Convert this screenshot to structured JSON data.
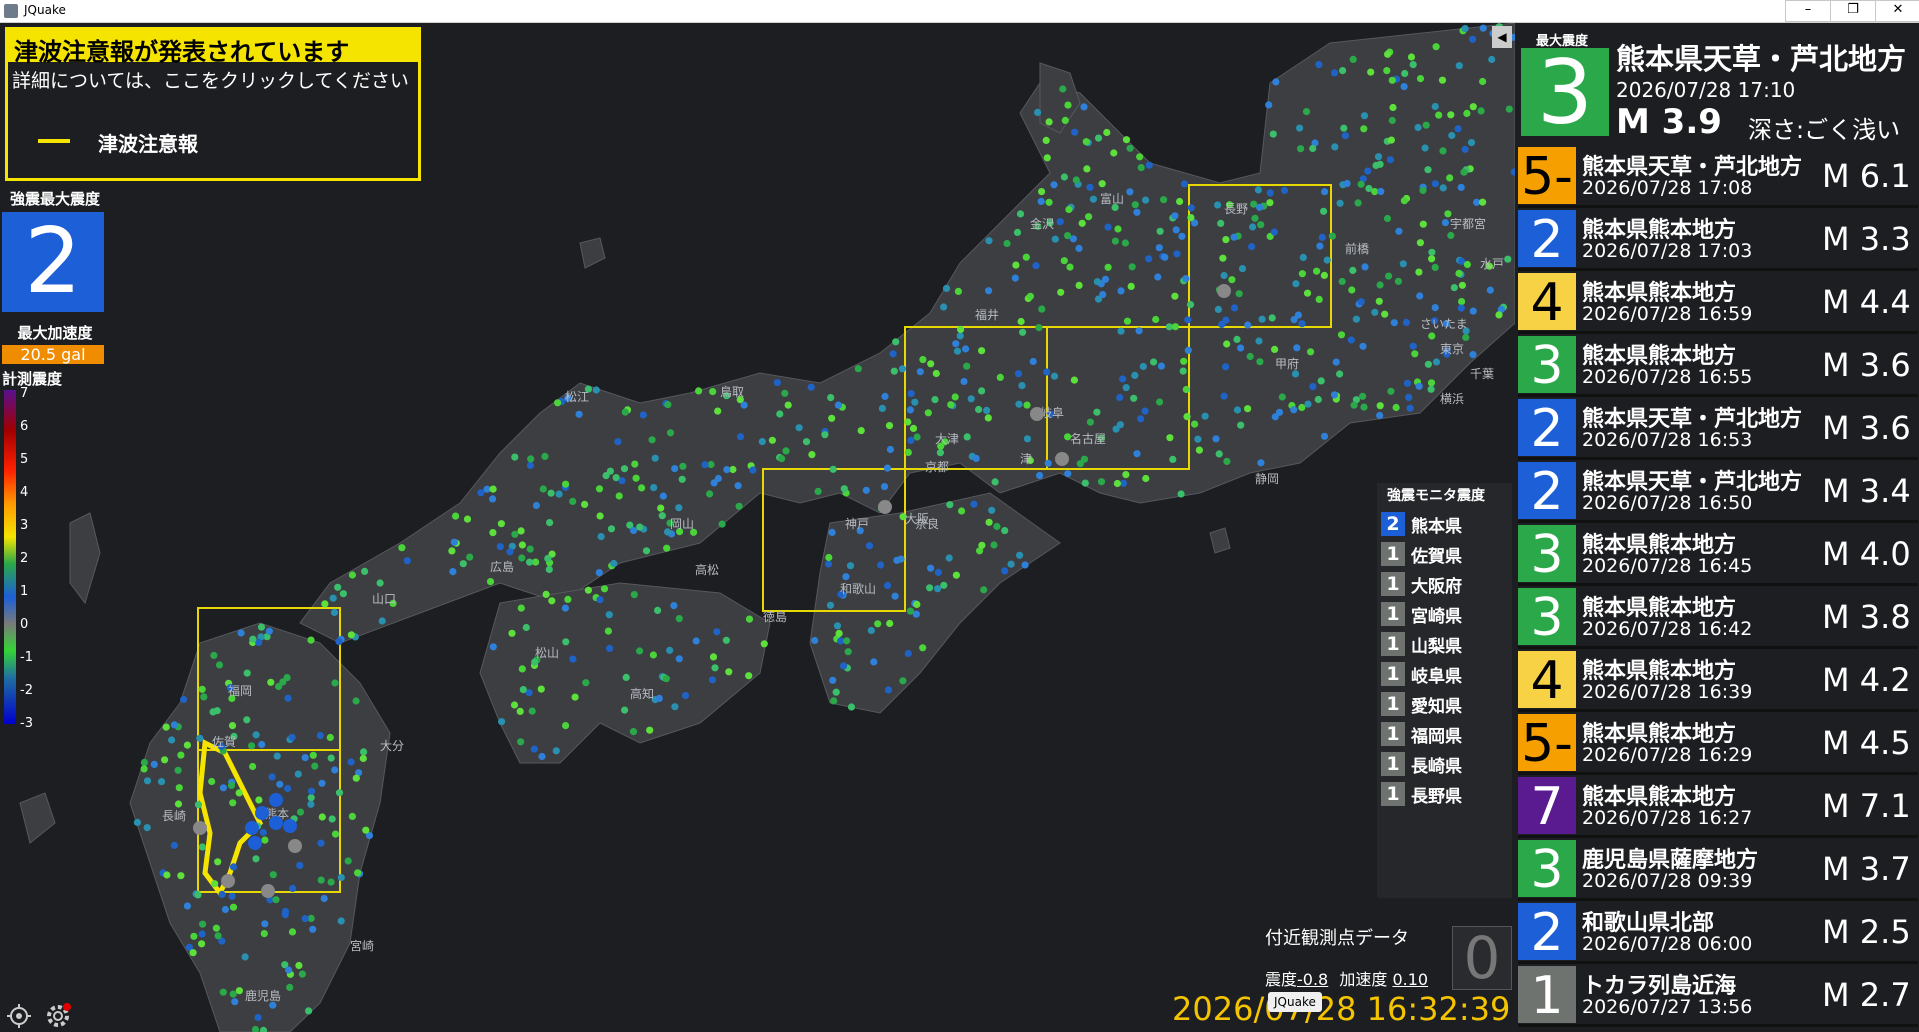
{
  "window": {
    "title": "JQuake",
    "minimize": "–",
    "maximize": "❐",
    "close": "✕"
  },
  "tsunami": {
    "header": "津波注意報が発表されています",
    "sub": "詳細については、ここをクリックしてください",
    "legend": "津波注意報"
  },
  "max_panel": {
    "label": "強震最大震度",
    "value": "2",
    "accel_label": "最大加速度",
    "accel_value": "20.5 gal"
  },
  "scale": {
    "label": "計測震度",
    "ticks": [
      "7",
      "6",
      "5",
      "4",
      "3",
      "2",
      "1",
      "0",
      "-1",
      "-2",
      "-3"
    ]
  },
  "map_labels": [
    "長野",
    "前橋",
    "宇都宮",
    "水戸",
    "さいたま",
    "東京",
    "千葉",
    "横浜",
    "甲府",
    "静岡",
    "岐阜",
    "名古屋",
    "津",
    "大津",
    "京都",
    "奈良",
    "大阪",
    "神戸",
    "和歌山",
    "富山",
    "金沢",
    "福井",
    "鳥取",
    "松江",
    "岡山",
    "広島",
    "山口",
    "高松",
    "徳島",
    "松山",
    "高知",
    "福岡",
    "佐賀",
    "長崎",
    "熊本",
    "大分",
    "宮崎",
    "鹿児島"
  ],
  "monitor": {
    "title": "強震モニタ震度",
    "rows": [
      {
        "value": "2",
        "pref": "熊本県"
      },
      {
        "value": "1",
        "pref": "佐賀県"
      },
      {
        "value": "1",
        "pref": "大阪府"
      },
      {
        "value": "1",
        "pref": "宮崎県"
      },
      {
        "value": "1",
        "pref": "山梨県"
      },
      {
        "value": "1",
        "pref": "岐阜県"
      },
      {
        "value": "1",
        "pref": "愛知県"
      },
      {
        "value": "1",
        "pref": "福岡県"
      },
      {
        "value": "1",
        "pref": "長崎県"
      },
      {
        "value": "1",
        "pref": "長野県"
      }
    ]
  },
  "nearby": {
    "title": "付近観測点データ",
    "intensity_label": "震度",
    "intensity": "-0.8",
    "accel_label": "加速度",
    "accel": "0.10",
    "big": "0"
  },
  "clock": "2026/07/28 16:32:39",
  "tooltip": "JQuake",
  "latest": {
    "label": "最大震度",
    "intensity": "3",
    "place": "熊本県天草・芦北地方",
    "time": "2026/07/28  17:10",
    "magnitude": "M 3.9",
    "depth": "深さ:ごく浅い"
  },
  "quakes": [
    {
      "intensity": "5-",
      "place": "熊本県天草・芦北地方",
      "time": "2026/07/28  17:08",
      "magnitude": "M 6.1",
      "color": "#f5a000"
    },
    {
      "intensity": "2",
      "place": "熊本県熊本地方",
      "time": "2026/07/28  17:03",
      "magnitude": "M 3.3",
      "color": "#1d5fd6"
    },
    {
      "intensity": "4",
      "place": "熊本県熊本地方",
      "time": "2026/07/28  16:59",
      "magnitude": "M 4.4",
      "color": "#f7d245"
    },
    {
      "intensity": "3",
      "place": "熊本県熊本地方",
      "time": "2026/07/28  16:55",
      "magnitude": "M 3.6",
      "color": "#2aa84a"
    },
    {
      "intensity": "2",
      "place": "熊本県天草・芦北地方",
      "time": "2026/07/28  16:53",
      "magnitude": "M 3.6",
      "color": "#1d5fd6"
    },
    {
      "intensity": "2",
      "place": "熊本県天草・芦北地方",
      "time": "2026/07/28  16:50",
      "magnitude": "M 3.4",
      "color": "#1d5fd6"
    },
    {
      "intensity": "3",
      "place": "熊本県熊本地方",
      "time": "2026/07/28  16:45",
      "magnitude": "M 4.0",
      "color": "#2aa84a"
    },
    {
      "intensity": "3",
      "place": "熊本県熊本地方",
      "time": "2026/07/28  16:42",
      "magnitude": "M 3.8",
      "color": "#2aa84a"
    },
    {
      "intensity": "4",
      "place": "熊本県熊本地方",
      "time": "2026/07/28  16:39",
      "magnitude": "M 4.2",
      "color": "#f7d245"
    },
    {
      "intensity": "5-",
      "place": "熊本県熊本地方",
      "time": "2026/07/28  16:29",
      "magnitude": "M 4.5",
      "color": "#f5a000"
    },
    {
      "intensity": "7",
      "place": "熊本県熊本地方",
      "time": "2026/07/28  16:27",
      "magnitude": "M 7.1",
      "color": "#5a1a90"
    },
    {
      "intensity": "3",
      "place": "鹿児島県薩摩地方",
      "time": "2026/07/28  09:39",
      "magnitude": "M 3.7",
      "color": "#2aa84a"
    },
    {
      "intensity": "2",
      "place": "和歌山県北部",
      "time": "2026/07/28  06:00",
      "magnitude": "M 2.5",
      "color": "#1d5fd6"
    },
    {
      "intensity": "1",
      "place": "トカラ列島近海",
      "time": "2026/07/27  13:56",
      "magnitude": "M 2.7",
      "color": "#6e7370"
    }
  ]
}
